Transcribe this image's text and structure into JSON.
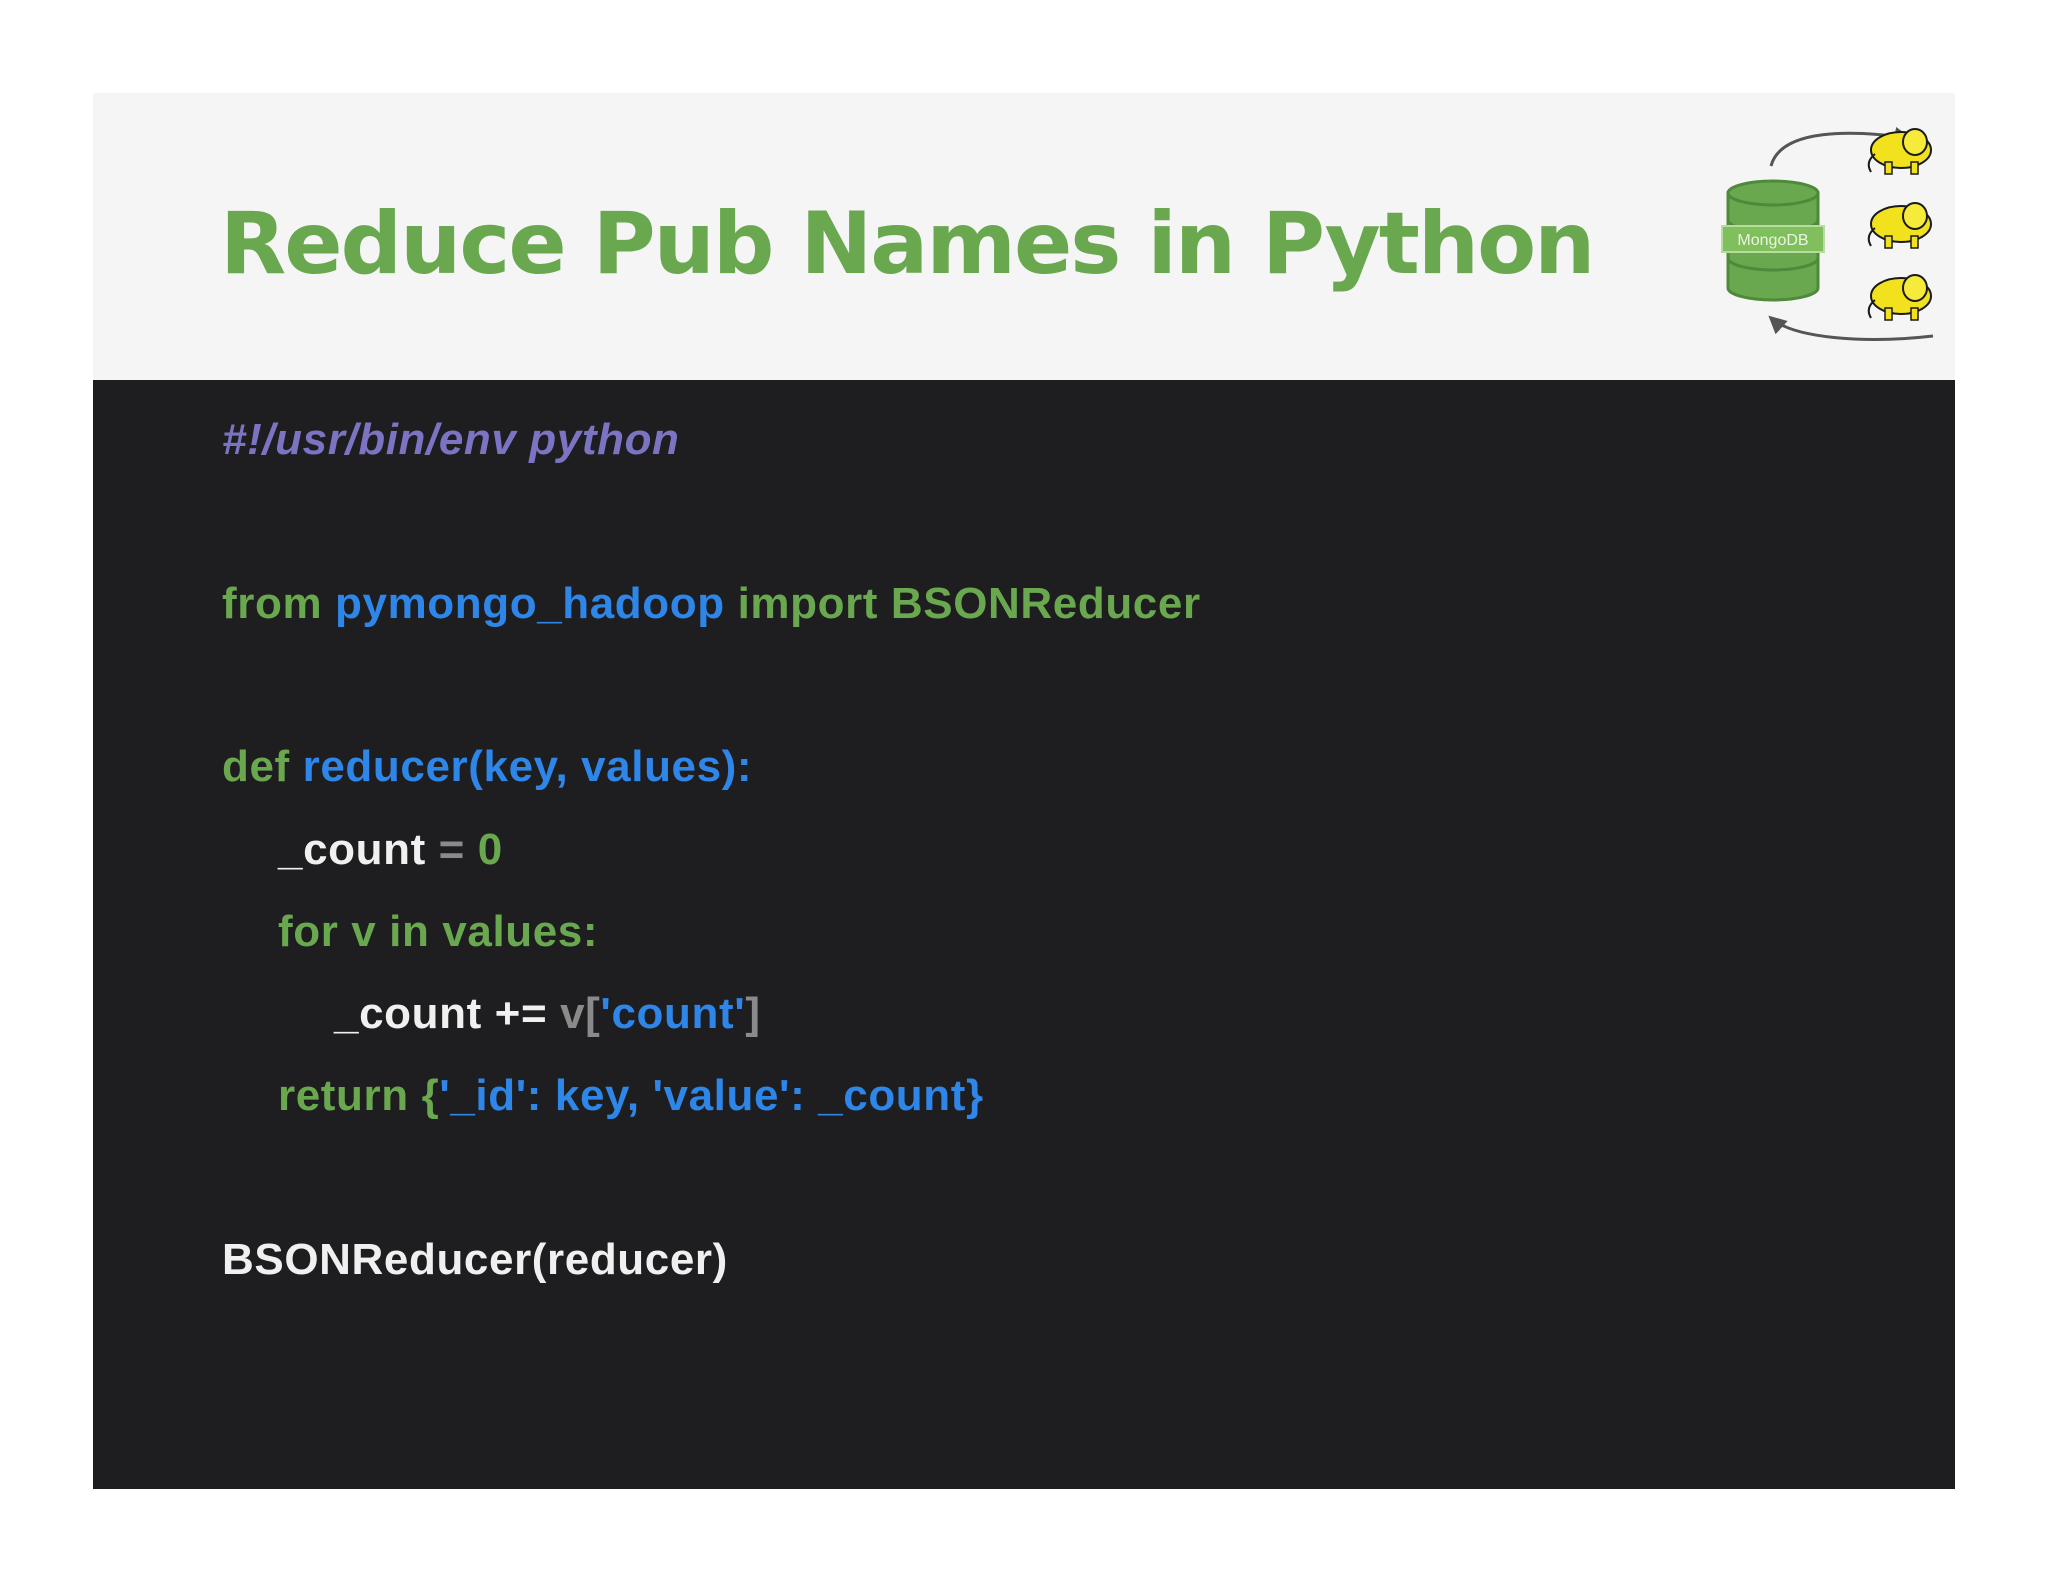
{
  "slide": {
    "title": "Reduce Pub Names in Python",
    "logo": {
      "label": "MongoDB",
      "icons": [
        "mongodb-cylinder-icon",
        "hadoop-elephant-icon",
        "hadoop-elephant-icon",
        "hadoop-elephant-icon",
        "arrow-right-icon",
        "arrow-left-icon"
      ]
    }
  },
  "code": {
    "line1": {
      "text": "#!/usr/bin/env python"
    },
    "line2": {
      "kw_from": "from",
      "module": "pymongo_hadoop",
      "kw_import": "import",
      "name": "BSONReducer"
    },
    "line3": {
      "kw_def": "def",
      "signature": "reducer(key, values):"
    },
    "line4": {
      "var": "_count",
      "op": "=",
      "num": "0"
    },
    "line5": {
      "text": "for v in values:"
    },
    "line6": {
      "var": "_count",
      "op": "+=",
      "v": "v",
      "open": "[",
      "key": "'count'",
      "close": "]"
    },
    "line7": {
      "kw_return": "return",
      "brace_open": "{",
      "body": "'_id': key, 'value': _count",
      "brace_close": "}"
    },
    "line8": {
      "text": "BSONReducer(reducer)"
    }
  },
  "colors": {
    "title_green": "#6aa84f",
    "header_bg": "#f5f5f5",
    "code_bg": "#1e1e20",
    "keyword_green": "#6aa84f",
    "identifier_blue": "#2e86e8",
    "comment_purple": "#7b74c2",
    "text_white": "#f0f0f0",
    "operator_gray": "#8a8a8a"
  }
}
